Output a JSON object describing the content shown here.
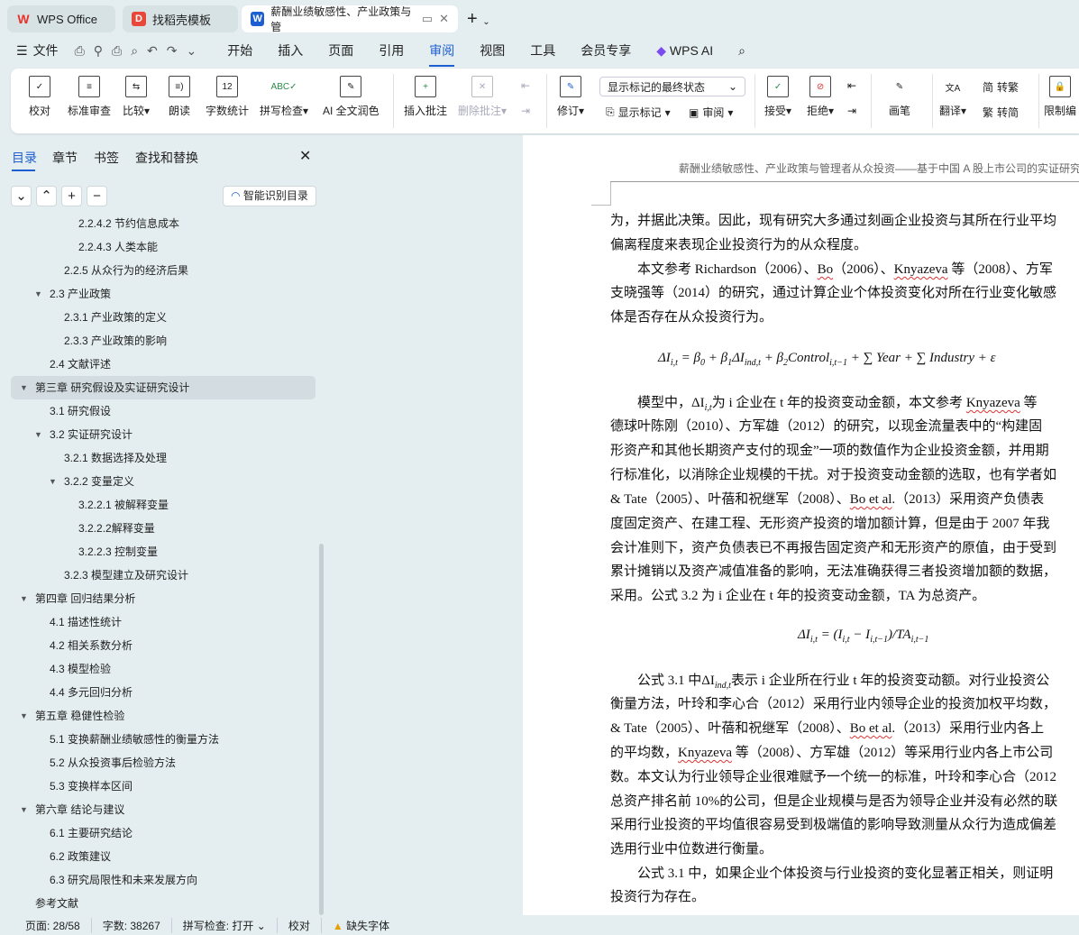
{
  "tabs": [
    {
      "label": "WPS Office",
      "icon": "wps-logo-icon"
    },
    {
      "label": "找稻壳模板",
      "icon": "docer-logo-icon"
    },
    {
      "label": "薪酬业绩敏感性、产业政策与管",
      "icon": "word-doc-icon"
    }
  ],
  "menu": {
    "file": "文件",
    "items": [
      "开始",
      "插入",
      "页面",
      "引用",
      "审阅",
      "视图",
      "工具",
      "会员专享"
    ],
    "active": "审阅",
    "ai": "WPS AI"
  },
  "ribbon": {
    "proofread": "校对",
    "std_review": "标准审查",
    "compare": "比较",
    "read_aloud": "朗读",
    "word_count": "字数统计",
    "spell_check": "拼写检查",
    "ai_polish": "AI 全文润色",
    "insert_comment": "插入批注",
    "delete_comment": "删除批注",
    "revise": "修订",
    "markup_state": "显示标记的最终状态",
    "show_markup": "显示标记",
    "review_pane": "审阅",
    "accept": "接受",
    "reject": "拒绝",
    "pen": "画笔",
    "translate": "翻译",
    "to_trad": "转繁",
    "to_simp": "转简",
    "restrict": "限制编"
  },
  "sidebar": {
    "tabs": [
      "目录",
      "章节",
      "书签",
      "查找和替换"
    ],
    "smart_toc": "智能识别目录",
    "toc": [
      {
        "label": "2.2.4.2  节约信息成本",
        "level": 4
      },
      {
        "label": "2.2.4.3  人类本能",
        "level": 4
      },
      {
        "label": "2.2.5  从众行为的经济后果",
        "level": 3
      },
      {
        "label": "2.3  产业政策",
        "level": 2,
        "expanded": true
      },
      {
        "label": "2.3.1  产业政策的定义",
        "level": 3
      },
      {
        "label": "2.3.3  产业政策的影响",
        "level": 3
      },
      {
        "label": "2.4  文献评述",
        "level": 2
      },
      {
        "label": "第三章  研究假设及实证研究设计",
        "level": 1,
        "expanded": true,
        "selected": true
      },
      {
        "label": "3.1  研究假设",
        "level": 2
      },
      {
        "label": "3.2  实证研究设计",
        "level": 2,
        "expanded": true
      },
      {
        "label": "3.2.1  数据选择及处理",
        "level": 3
      },
      {
        "label": "3.2.2  变量定义",
        "level": 3,
        "expanded": true
      },
      {
        "label": "3.2.2.1  被解释变量",
        "level": 4
      },
      {
        "label": "3.2.2.2解释变量",
        "level": 4
      },
      {
        "label": "3.2.2.3  控制变量",
        "level": 4
      },
      {
        "label": "3.2.3  模型建立及研究设计",
        "level": 3
      },
      {
        "label": "第四章  回归结果分析",
        "level": 1,
        "expanded": true
      },
      {
        "label": "4.1  描述性统计",
        "level": 2
      },
      {
        "label": "4.2  相关系数分析",
        "level": 2
      },
      {
        "label": "4.3  模型检验",
        "level": 2
      },
      {
        "label": "4.4  多元回归分析",
        "level": 2
      },
      {
        "label": "第五章  稳健性检验",
        "level": 1,
        "expanded": true
      },
      {
        "label": "5.1  变换薪酬业绩敏感性的衡量方法",
        "level": 2
      },
      {
        "label": "5.2  从众投资事后检验方法",
        "level": 2
      },
      {
        "label": "5.3  变换样本区间",
        "level": 2
      },
      {
        "label": "第六章  结论与建议",
        "level": 1,
        "expanded": true
      },
      {
        "label": "6.1  主要研究结论",
        "level": 2
      },
      {
        "label": "6.2  政策建议",
        "level": 2
      },
      {
        "label": "6.3  研究局限性和未来发展方向",
        "level": 2
      },
      {
        "label": "参考文献",
        "level": 1
      }
    ]
  },
  "document": {
    "header": "薪酬业绩敏感性、产业政策与管理者从众投资——基于中国 A 股上市公司的实证研究",
    "lines": [
      [
        "为，并据此决策。因此，现有研究大多通过刻画企业投资与其所在行业平均"
      ],
      [
        "偏离程度来表现企业投资行为的从众程度。"
      ],
      [
        "　　本文参考 Richardson（2006）、",
        {
          "w": "Bo"
        },
        "（2006）、",
        {
          "w": "Knyazeva"
        },
        " 等（2008）、方军"
      ],
      [
        "支晓强等（2014）的研究，通过计算企业个体投资变化对所在行业变化敏感"
      ],
      [
        "体是否存在从众投资行为。"
      ],
      {
        "formula": [
          {
            "t": "ΔI"
          },
          {
            "s": "i,t"
          },
          {
            "t": " = β"
          },
          {
            "s": "0"
          },
          {
            "t": " + β"
          },
          {
            "s": "1"
          },
          {
            "t": "ΔI"
          },
          {
            "s": "ind,t"
          },
          {
            "t": " + β"
          },
          {
            "s": "2"
          },
          {
            "t": "Control"
          },
          {
            "s": "i,t−1"
          },
          {
            "t": " + ∑ Year + ∑ Industry + ε"
          }
        ]
      },
      [
        "　　模型中，ΔI",
        {
          "s": "i,t"
        },
        "为 i 企业在 t 年的投资变动金额，本文参考 ",
        {
          "w": "Knyazeva"
        },
        " 等"
      ],
      [
        "德球叶陈刚（2010）、方军雄（2012）的研究，以现金流量表中的“构建固"
      ],
      [
        "形资产和其他长期资产支付的现金”一项的数值作为企业投资金额，并用期"
      ],
      [
        "行标准化，以消除企业规模的干扰。对于投资变动金额的选取，也有学者如"
      ],
      [
        "& Tate（2005）、叶蓓和祝继军（2008）、",
        {
          "w": "Bo et al"
        },
        ".（2013）采用资产负债表"
      ],
      [
        "度固定资产、在建工程、无形资产投资的增加额计算，但是由于 2007 年我"
      ],
      [
        "会计准则下，资产负债表已不再报告固定资产和无形资产的原值，由于受到"
      ],
      [
        "累计摊销以及资产减值准备的影响，无法准确获得三者投资增加额的数据，"
      ],
      [
        "采用。公式 3.2 为 i 企业在 t 年的投资变动金额，TA 为总资产。"
      ],
      {
        "formula": [
          {
            "t": "ΔI"
          },
          {
            "s": "i,t"
          },
          {
            "t": " = (I"
          },
          {
            "s": "i,t"
          },
          {
            "t": " − I"
          },
          {
            "s": "i,t−1"
          },
          {
            "t": ")/TA"
          },
          {
            "s": "i,t−1"
          }
        ]
      },
      [
        "　　公式 3.1 中ΔI",
        {
          "s": "ind,t"
        },
        "表示 i 企业所在行业 t 年的投资变动额。对行业投资公"
      ],
      [
        "衡量方法，叶玲和李心合（2012）采用行业内领导企业的投资加权平均数，"
      ],
      [
        "& Tate（2005）、叶蓓和祝继军（2008）、",
        {
          "w": "Bo et al"
        },
        ".（2013）采用行业内各上"
      ],
      [
        "的平均数，",
        {
          "w": "Knyazeva"
        },
        " 等（2008）、方军雄（2012）等采用行业内各上市公司"
      ],
      [
        "数。本文认为行业领导企业很难赋予一个统一的标准，叶玲和李心合（2012"
      ],
      [
        "总资产排名前 10%的公司，但是企业规模与是否为领导企业并没有必然的联"
      ],
      [
        "采用行业投资的平均值很容易受到极端值的影响导致测量从众行为造成偏差"
      ],
      [
        "选用行业中位数进行衡量。"
      ],
      [
        "　　公式 3.1 中，如果企业个体投资与行业投资的变化显著正相关，则证明"
      ],
      [
        "投资行为存在。"
      ]
    ]
  },
  "status": {
    "page": "页面: 28/58",
    "words": "字数: 38267",
    "spell": "拼写检查: 打开",
    "proof": "校对",
    "missing_font": "缺失字体"
  },
  "colors": {
    "accent": "#1d5fd1",
    "wps_red": "#e8332a",
    "spell_underline": "#d33"
  }
}
